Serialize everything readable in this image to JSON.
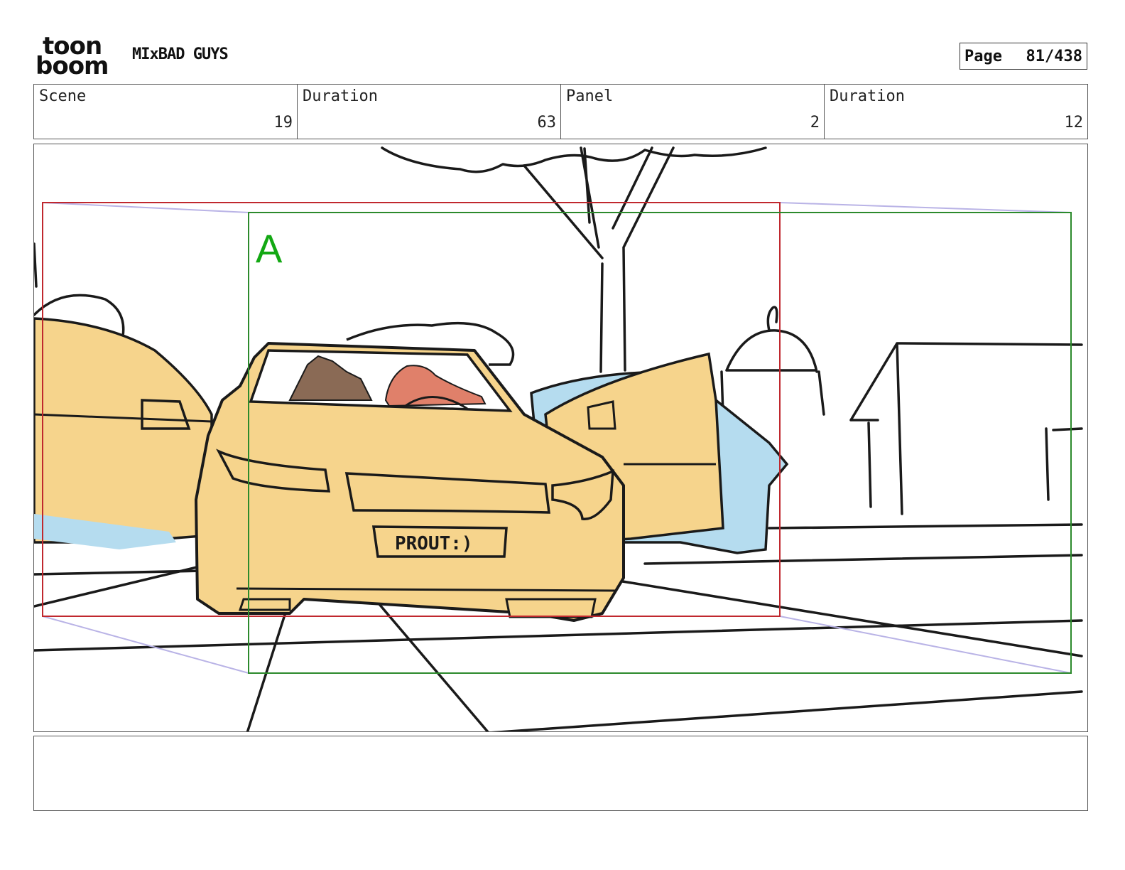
{
  "header": {
    "logo": {
      "line1": "toon",
      "line2": "boom"
    },
    "project_title": "MIxBAD GUYS",
    "page": {
      "label": "Page",
      "value": "81/438"
    }
  },
  "info": {
    "scene": {
      "label": "Scene",
      "value": "19"
    },
    "scene_duration": {
      "label": "Duration",
      "value": "63"
    },
    "panel": {
      "label": "Panel",
      "value": "2"
    },
    "panel_duration": {
      "label": "Duration",
      "value": "12"
    }
  },
  "panel_art": {
    "camera_label": "A",
    "license_plate": "PROUT:)",
    "colors": {
      "car_yellow": "#f6d48c",
      "car_blue": "#b5dcef",
      "frame_red": "#c0282e",
      "frame_green": "#2c8a2c",
      "label_green": "#13a813",
      "guide_lavender": "#b9b3e6",
      "ink": "#1a1a1a"
    }
  },
  "notes": {
    "text": ""
  }
}
